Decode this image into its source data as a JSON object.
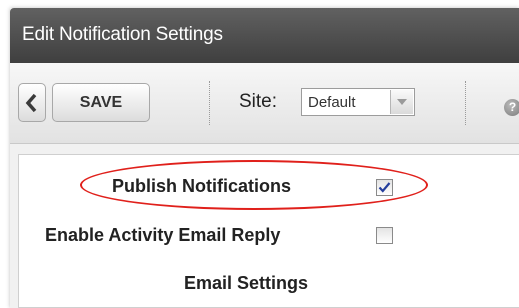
{
  "window": {
    "title": "Edit Notification Settings"
  },
  "toolbar": {
    "back_icon": "chevron-left-icon",
    "save_label": "SAVE",
    "site_label": "Site:",
    "site_select": {
      "selected": "Default"
    },
    "help_icon": "question-icon",
    "help_glyph": "?"
  },
  "settings": {
    "publish_notifications": {
      "label": "Publish Notifications",
      "checked": true
    },
    "enable_activity_email_reply": {
      "label": "Enable Activity Email Reply",
      "checked": false
    },
    "email_settings_heading": "Email Settings"
  },
  "annotation": {
    "highlight_color": "#e0201b"
  }
}
